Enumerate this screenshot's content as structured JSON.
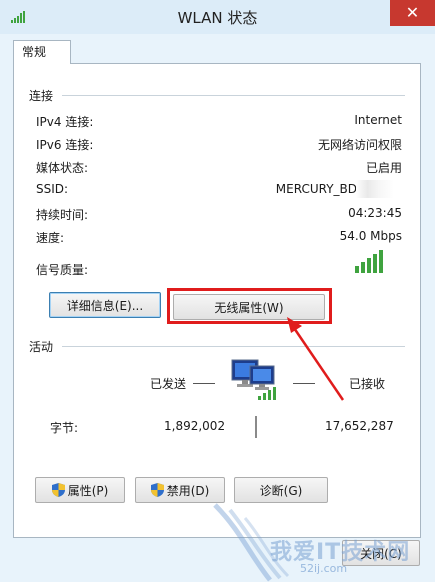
{
  "window": {
    "title": "WLAN 状态",
    "close_symbol": "✕"
  },
  "tabs": [
    {
      "label": "常规"
    }
  ],
  "connection": {
    "header": "连接",
    "rows": [
      {
        "label": "IPv4 连接:",
        "value": "Internet"
      },
      {
        "label": "IPv6 连接:",
        "value": "无网络访问权限"
      },
      {
        "label": "媒体状态:",
        "value": "已启用"
      },
      {
        "label": "SSID:",
        "value": "MERCURY_BD"
      },
      {
        "label": "持续时间:",
        "value": "04:23:45"
      },
      {
        "label": "速度:",
        "value": "54.0 Mbps"
      }
    ],
    "signal_label": "信号质量:",
    "signal_bars": 5,
    "buttons": {
      "details": "详细信息(E)...",
      "wireless_properties": "无线属性(W)"
    }
  },
  "activity": {
    "header": "活动",
    "sent_label": "已发送",
    "received_label": "已接收",
    "bytes_label": "字节:",
    "bytes_sent": "1,892,002",
    "bytes_received": "17,652,287"
  },
  "bottom_buttons": {
    "properties": "属性(P)",
    "disable": "禁用(D)",
    "diagnose": "诊断(G)"
  },
  "close_button": "关闭(C)",
  "watermark": {
    "text": "我爱IT技术网",
    "url": "52ij.com"
  },
  "colors": {
    "highlight": "#e01c1c",
    "signal": "#3fa33f",
    "accent": "#3c7fb1"
  }
}
